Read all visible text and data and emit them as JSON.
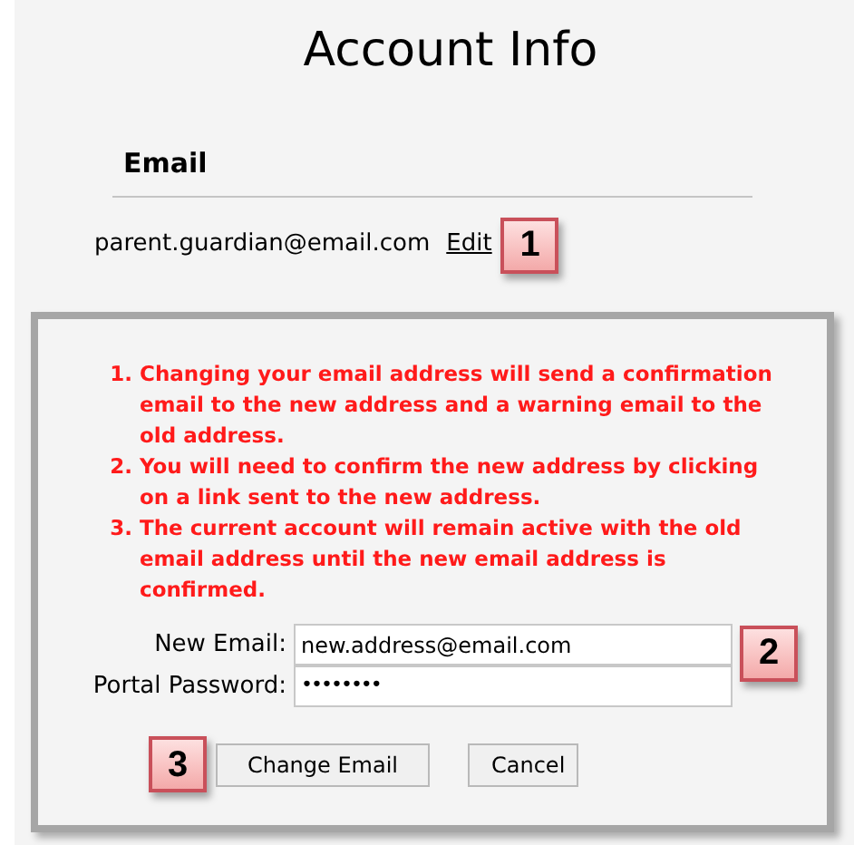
{
  "title": "Account Info",
  "section": {
    "heading": "Email",
    "current_email": "parent.guardian@email.com",
    "edit_link": "Edit",
    "callout": "1"
  },
  "dialog": {
    "notes": [
      {
        "number": "1.",
        "text": "Changing your email address will send a confirmation email to the new address and a warning email to the old address."
      },
      {
        "number": "2.",
        "text": "You will need to confirm the new address by clicking on a link sent to the new address."
      },
      {
        "number": "3.",
        "text": "The current account will remain active with the old email address until the new email address is confirmed."
      }
    ],
    "fields": [
      {
        "label": "New Email:",
        "kind": "text",
        "value": "new.address@email.com"
      },
      {
        "label": "Portal Password:",
        "kind": "password",
        "value": "••••••••"
      }
    ],
    "fields_callout": "2",
    "buttons_callout": "3",
    "buttons": [
      {
        "label": "Change Email"
      },
      {
        "label": "Cancel"
      }
    ]
  }
}
